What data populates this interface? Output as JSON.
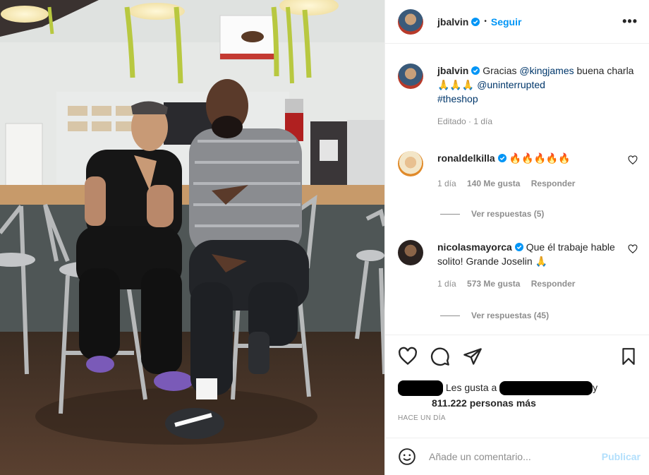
{
  "post": {
    "author": "jbalvin",
    "dot": "•",
    "follow_label": "Seguir",
    "more_label": "•••",
    "caption": {
      "username": "jbalvin",
      "text_1": " Gracias ",
      "mention_1": "@kingjames",
      "text_2": " buena charla 🙏🙏🙏 ",
      "mention_2": "@uninterrupted",
      "hashtag": "#theshop",
      "meta": "Editado · 1 día"
    }
  },
  "comments": [
    {
      "username": "ronaldelkilla",
      "text": "🔥🔥🔥🔥🔥",
      "time": "1 día",
      "likes": "140 Me gusta",
      "reply_label": "Responder",
      "view_replies": "Ver respuestas (5)"
    },
    {
      "username": "nicolasmayorca",
      "text": "Que él trabaje hable solito! Grande Joselin 🙏",
      "time": "1 día",
      "likes": "573 Me gusta",
      "reply_label": "Responder",
      "view_replies": "Ver respuestas (45)"
    }
  ],
  "likes": {
    "prefix": "Les gusta a",
    "suffix": "y",
    "count_text": "811.222 personas más"
  },
  "time_ago": "HACE UN DÍA",
  "add_comment": {
    "placeholder": "Añade un comentario...",
    "publish_label": "Publicar"
  },
  "icons": {
    "verified": "verified-badge-icon",
    "like": "heart-icon",
    "comment": "comment-icon",
    "share": "send-icon",
    "save": "bookmark-icon",
    "emoji": "emoji-icon",
    "options": "more-options-icon"
  },
  "colors": {
    "link_blue": "#0095f6",
    "mention_blue": "#00376b",
    "muted_gray": "#8e8e8e",
    "publish_disabled": "#b2dffc",
    "fire": "#e8561c"
  }
}
